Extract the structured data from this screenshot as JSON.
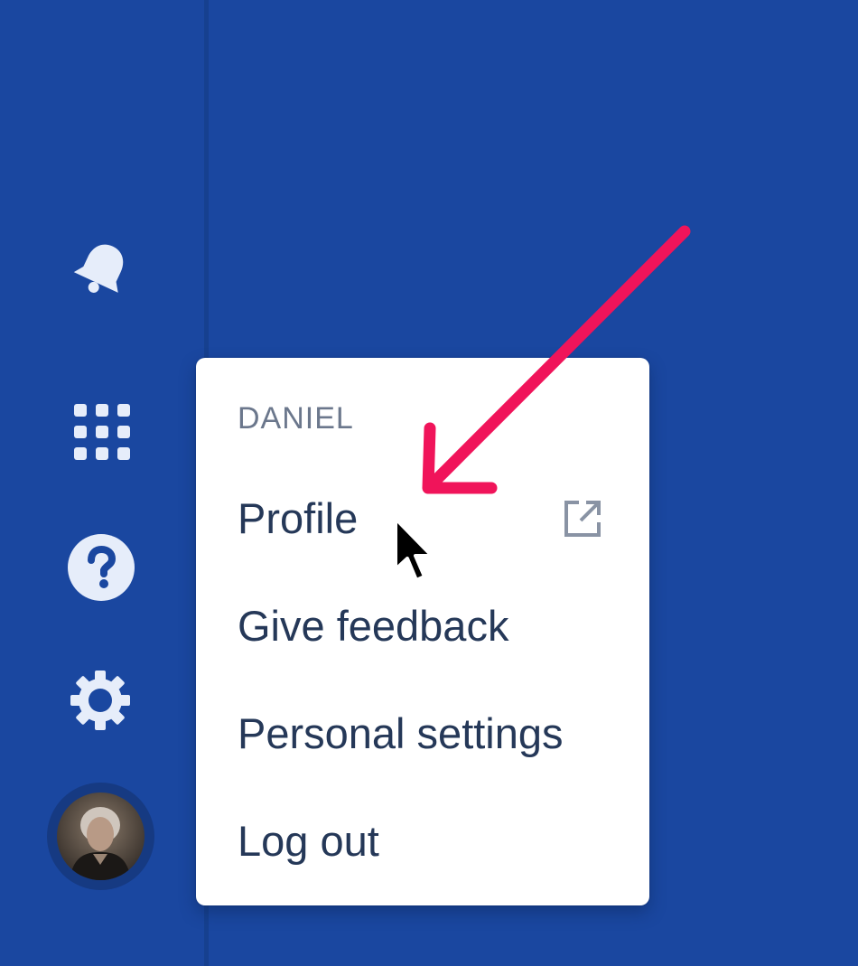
{
  "sidebar": {
    "icons": [
      "bell-icon",
      "app-switcher-icon",
      "help-icon",
      "settings-icon"
    ],
    "avatar": "user-avatar"
  },
  "account_menu": {
    "heading": "DANIEL",
    "items": [
      {
        "label": "Profile",
        "icon": "external-link-icon"
      },
      {
        "label": "Give feedback"
      },
      {
        "label": "Personal settings"
      },
      {
        "label": "Log out"
      }
    ]
  },
  "annotation": {
    "icon": "arrow-icon",
    "color": "#f0145a"
  },
  "colors": {
    "nav_background": "#1a47a0",
    "menu_background": "#ffffff",
    "menu_text": "#253858",
    "heading_text": "#6b778c"
  }
}
